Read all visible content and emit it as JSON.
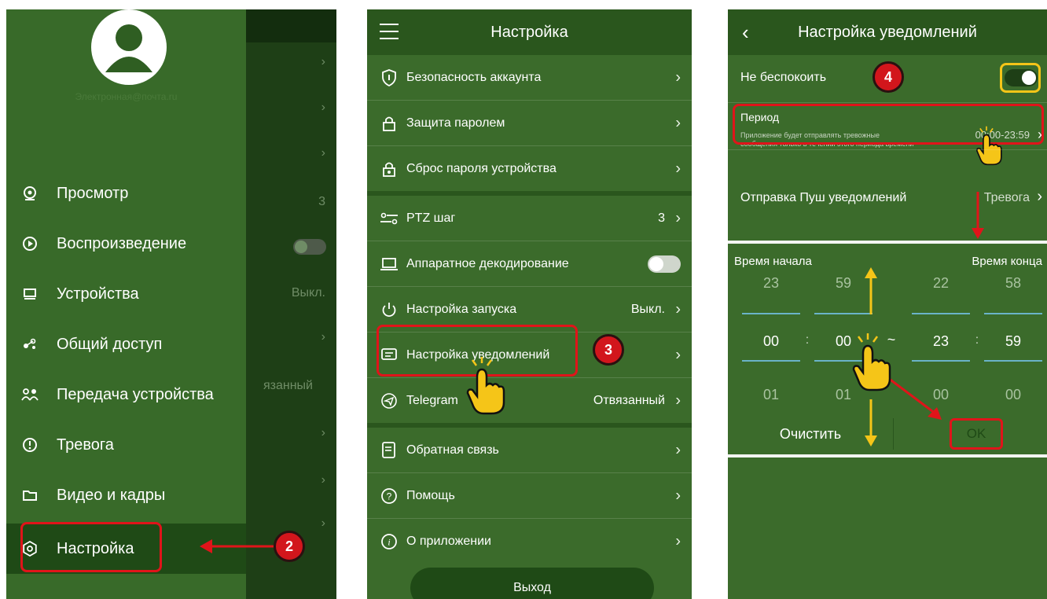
{
  "panel1": {
    "email": "Электронная@почта.ru",
    "menu": [
      {
        "label": "Просмотр",
        "icon": "view-icon"
      },
      {
        "label": "Воспроизведение",
        "icon": "play-icon"
      },
      {
        "label": "Устройства",
        "icon": "devices-icon"
      },
      {
        "label": "Общий доступ",
        "icon": "share-icon"
      },
      {
        "label": "Передача устройства",
        "icon": "transfer-icon"
      },
      {
        "label": "Тревога",
        "icon": "alarm-icon"
      },
      {
        "label": "Видео и кадры",
        "icon": "folder-icon"
      },
      {
        "label": "Настройка",
        "icon": "gear-icon"
      }
    ],
    "bg_values": {
      "ptz": "3",
      "startup": "Выкл.",
      "telegram": "язанный"
    },
    "badge": "2"
  },
  "panel2": {
    "title": "Настройка",
    "rows": [
      {
        "label": "Безопасность аккаунта",
        "value": ""
      },
      {
        "label": "Защита паролем",
        "value": ""
      },
      {
        "label": "Сброс пароля устройства",
        "value": ""
      },
      {
        "label": "PTZ шаг",
        "value": "3"
      },
      {
        "label": "Аппаратное декодирование",
        "value": ""
      },
      {
        "label": "Настройка запуска",
        "value": "Выкл."
      },
      {
        "label": "Настройка уведомлений",
        "value": ""
      },
      {
        "label": "Telegram",
        "value": "Отвязанный"
      },
      {
        "label": "Обратная связь",
        "value": ""
      },
      {
        "label": "Помощь",
        "value": ""
      },
      {
        "label": "О приложении",
        "value": ""
      }
    ],
    "exit": "Выход",
    "badge": "3"
  },
  "panel3": {
    "title": "Настройка уведомлений",
    "dnd_label": "Не беспокоить",
    "period_label": "Период",
    "period_desc_1": "Приложение будет отправлять тревожные",
    "period_desc_2": "сообщения только в течении этого периода времени",
    "period_value": "00:00-23:59",
    "push_label": "Отправка Пуш уведомлений",
    "push_value": "Тревога",
    "start_label": "Время начала",
    "end_label": "Время конца",
    "picker": {
      "top": [
        "23",
        "59",
        "22",
        "58"
      ],
      "mid": [
        "00",
        "00",
        "23",
        "59"
      ],
      "bot": [
        "01",
        "01",
        "00",
        "00"
      ]
    },
    "tilde": "~",
    "colon": ":",
    "clear": "Очистить",
    "ok": "OK",
    "badge": "4"
  },
  "colors": {
    "dark_green": "#274f1c",
    "mid_green": "#3b6b2b",
    "header_green": "#2a561d",
    "red": "#e0141a",
    "yellow": "#f5c518"
  }
}
